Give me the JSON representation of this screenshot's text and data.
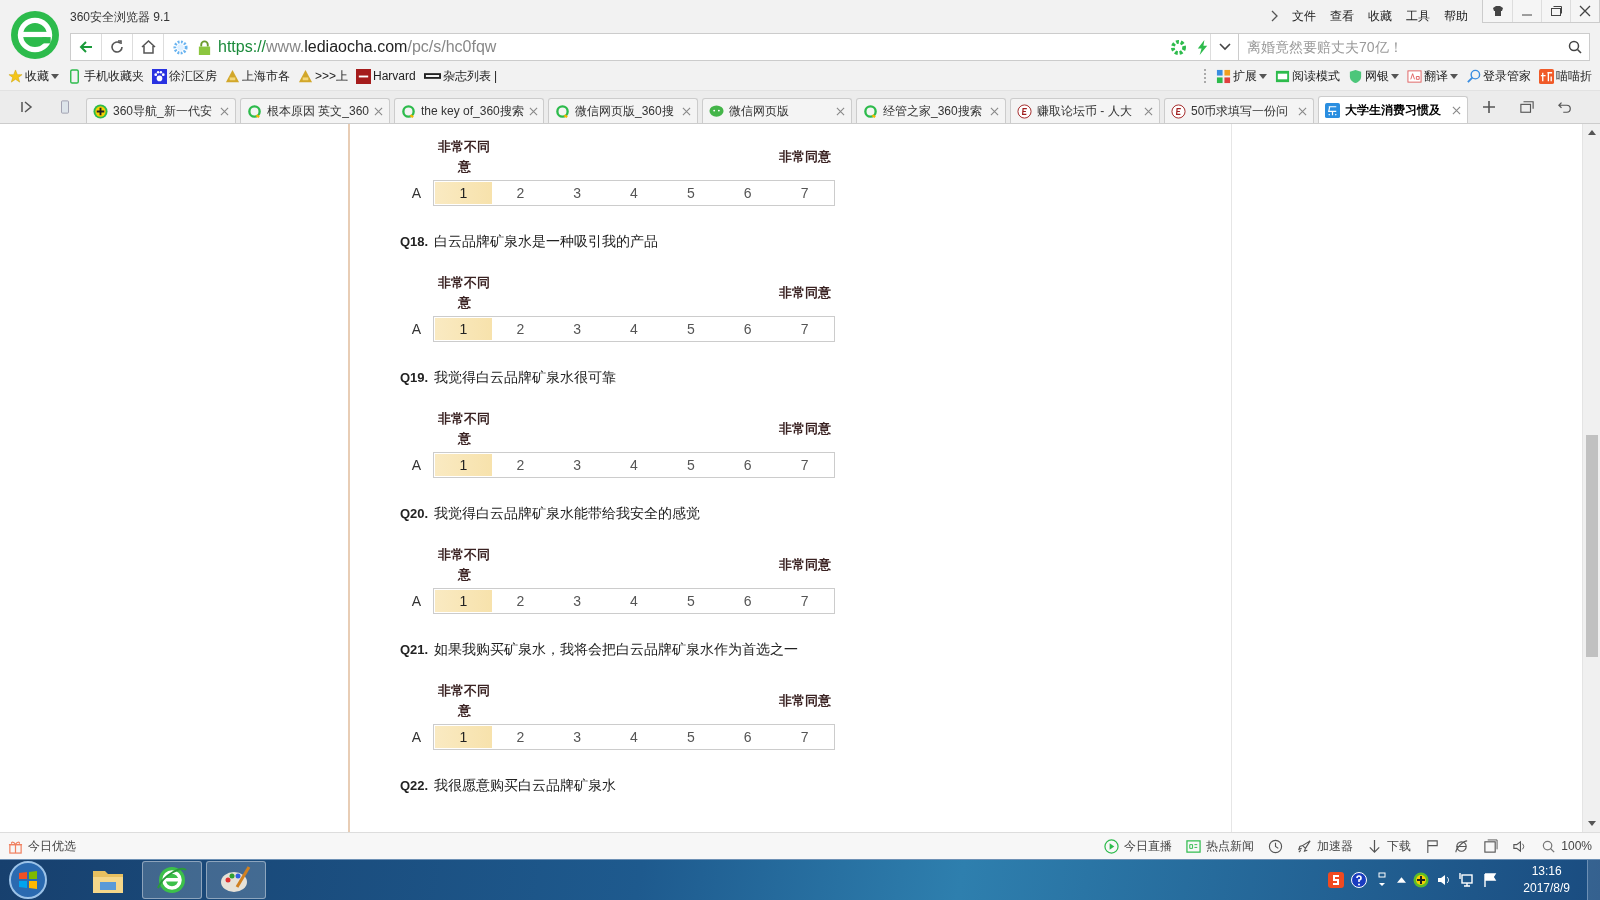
{
  "window": {
    "title": "360安全浏览器 9.1",
    "menu": [
      "文件",
      "查看",
      "收藏",
      "工具",
      "帮助"
    ]
  },
  "address": {
    "url_parts": [
      {
        "text": "https://",
        "kind": "scheme"
      },
      {
        "text": "www.",
        "kind": "host"
      },
      {
        "text": "lediaocha.com",
        "kind": "domain"
      },
      {
        "text": "/pc/s/hc0fqw",
        "kind": "path"
      }
    ],
    "search_placeholder": "离婚竟然要赔丈夫70亿！"
  },
  "bookmarks": [
    "收藏",
    "手机收藏夹",
    "徐汇区房",
    "上海市各",
    ">>>上",
    "Harvard",
    "杂志列表 |"
  ],
  "toolbar_right": [
    "扩展",
    "阅读模式",
    "网银",
    "翻译",
    "登录管家",
    "喵喵折"
  ],
  "tabs": [
    {
      "label": "360导航_新一代安",
      "kind": "plus",
      "selected": false
    },
    {
      "label": "根本原因 英文_360",
      "kind": "search",
      "selected": false
    },
    {
      "label": "the key of_360搜索",
      "kind": "search",
      "selected": false
    },
    {
      "label": "微信网页版_360搜",
      "kind": "search",
      "selected": false
    },
    {
      "label": "微信网页版",
      "kind": "chat",
      "selected": false
    },
    {
      "label": "经管之家_360搜索",
      "kind": "search",
      "selected": false
    },
    {
      "label": "赚取论坛币 - 人大",
      "kind": "forum",
      "selected": false
    },
    {
      "label": "50币求填写一份问",
      "kind": "forum",
      "selected": false
    },
    {
      "label": "大学生消费习惯及",
      "kind": "survey",
      "selected": true
    }
  ],
  "questions": [
    {
      "left_label": "非常不同意",
      "right_label": "非常同意",
      "row_label": "A",
      "options": [
        {
          "label": "1",
          "selected": true
        },
        {
          "label": "2",
          "selected": false
        },
        {
          "label": "3",
          "selected": false
        },
        {
          "label": "4",
          "selected": false
        },
        {
          "label": "5",
          "selected": false
        },
        {
          "label": "6",
          "selected": false
        },
        {
          "label": "7",
          "selected": false
        }
      ]
    },
    {
      "number": "Q18.",
      "text": "白云品牌矿泉水是一种吸引我的产品",
      "left_label": "非常不同意",
      "right_label": "非常同意",
      "row_label": "A",
      "options": [
        {
          "label": "1",
          "selected": true
        },
        {
          "label": "2",
          "selected": false
        },
        {
          "label": "3",
          "selected": false
        },
        {
          "label": "4",
          "selected": false
        },
        {
          "label": "5",
          "selected": false
        },
        {
          "label": "6",
          "selected": false
        },
        {
          "label": "7",
          "selected": false
        }
      ]
    },
    {
      "number": "Q19.",
      "text": "我觉得白云品牌矿泉水很可靠",
      "left_label": "非常不同意",
      "right_label": "非常同意",
      "row_label": "A",
      "options": [
        {
          "label": "1",
          "selected": true
        },
        {
          "label": "2",
          "selected": false
        },
        {
          "label": "3",
          "selected": false
        },
        {
          "label": "4",
          "selected": false
        },
        {
          "label": "5",
          "selected": false
        },
        {
          "label": "6",
          "selected": false
        },
        {
          "label": "7",
          "selected": false
        }
      ]
    },
    {
      "number": "Q20.",
      "text": "我觉得白云品牌矿泉水能带给我安全的感觉",
      "left_label": "非常不同意",
      "right_label": "非常同意",
      "row_label": "A",
      "options": [
        {
          "label": "1",
          "selected": true
        },
        {
          "label": "2",
          "selected": false
        },
        {
          "label": "3",
          "selected": false
        },
        {
          "label": "4",
          "selected": false
        },
        {
          "label": "5",
          "selected": false
        },
        {
          "label": "6",
          "selected": false
        },
        {
          "label": "7",
          "selected": false
        }
      ]
    },
    {
      "number": "Q21.",
      "text": "如果我购买矿泉水，我将会把白云品牌矿泉水作为首选之一",
      "left_label": "非常不同意",
      "right_label": "非常同意",
      "row_label": "A",
      "options": [
        {
          "label": "1",
          "selected": true
        },
        {
          "label": "2",
          "selected": false
        },
        {
          "label": "3",
          "selected": false
        },
        {
          "label": "4",
          "selected": false
        },
        {
          "label": "5",
          "selected": false
        },
        {
          "label": "6",
          "selected": false
        },
        {
          "label": "7",
          "selected": false
        }
      ]
    },
    {
      "number": "Q22.",
      "text": "我很愿意购买白云品牌矿泉水"
    }
  ],
  "status_bar": {
    "left": "今日优选",
    "items": [
      "今日直播",
      "热点新闻",
      "加速器",
      "下载"
    ],
    "zoom": "100%"
  },
  "taskbar": {
    "time": "13:16",
    "date": "2017/8/9"
  }
}
